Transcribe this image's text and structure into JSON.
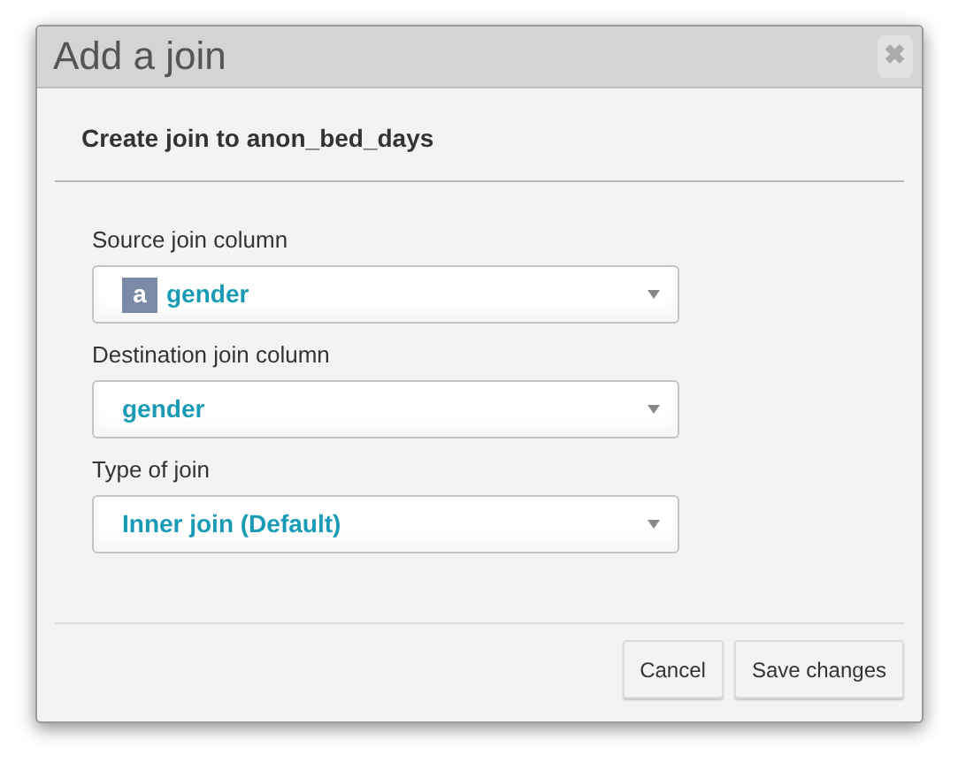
{
  "window": {
    "title": "Add a join",
    "close": "✖"
  },
  "subtitle": "Create join to anon_bed_days",
  "fields": [
    {
      "label": "Source join column",
      "value": "gender",
      "type_badge": "a"
    },
    {
      "label": "Destination join column",
      "value": "gender"
    },
    {
      "label": "Type of join",
      "value": "Inner join (Default)"
    }
  ],
  "buttons": [
    "Cancel",
    "Save changes"
  ]
}
